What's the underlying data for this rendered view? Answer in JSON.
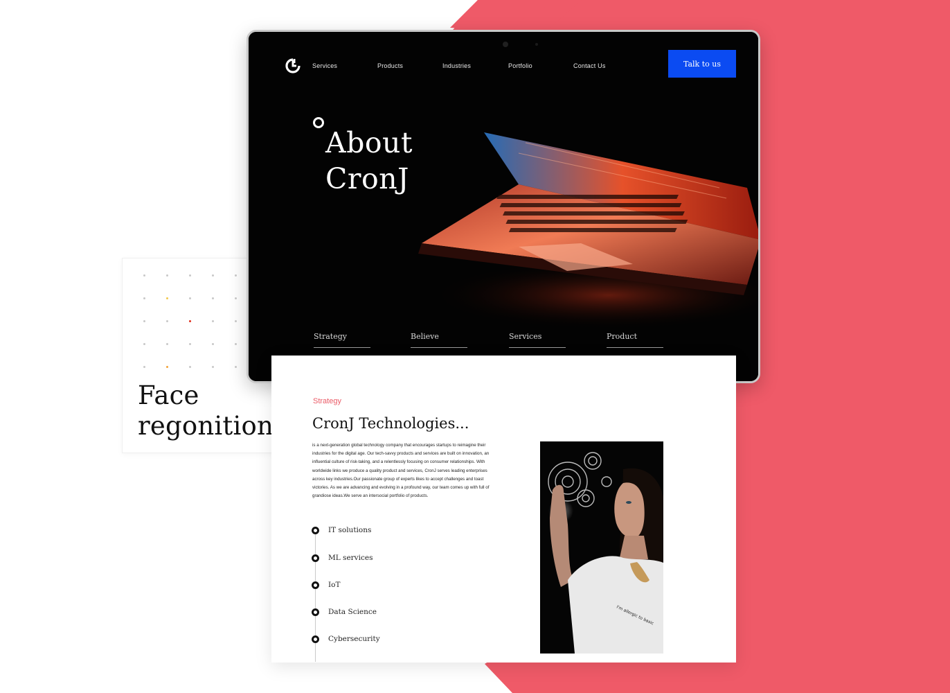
{
  "colors": {
    "accent": "#ef5a68",
    "primary_button": "#0b4bf2",
    "hero_background": "#030303",
    "text_dark": "#111111"
  },
  "side_card": {
    "title_line1": "Face",
    "title_line2": "regonition",
    "dot_grid": {
      "rows": 5,
      "cols": 5,
      "highlight_colors": [
        "#f2c94c",
        "#e0301e",
        "#f2a33a"
      ]
    }
  },
  "nav": {
    "logo_icon": "cronj-logo-icon",
    "items": [
      "Services",
      "Products",
      "Industries",
      "Portfolio",
      "Contact Us"
    ],
    "cta_label": "Talk to us"
  },
  "hero": {
    "title_line1": "About",
    "title_line2": "CronJ",
    "tabs": [
      "Strategy",
      "Believe",
      "Services",
      "Product"
    ]
  },
  "content": {
    "eyebrow": "Strategy",
    "title": "CronJ Technologies...",
    "body": "is a next-generation global technology company that encourages startups to reimagine their industries for the digital age. Our tech-savvy products and services are built on innovation, an influential culture of risk-taking, and a relentlessly focusing on consumer relationships. With worldwide links we produce a quality product and services, CronJ serves leading enterprises across key industries.Our passionate group of experts likes to accept challenges and toast victories. As we are advancing and evolving in a profound way, our team comes up with full of grandiose ideas.We serve an intersocial portfolio of products.",
    "features": [
      "IT solutions",
      "ML services",
      "IoT",
      "Data Science",
      "Cybersecurity"
    ],
    "portrait_shirt_text": "I'm allergic to basic"
  }
}
